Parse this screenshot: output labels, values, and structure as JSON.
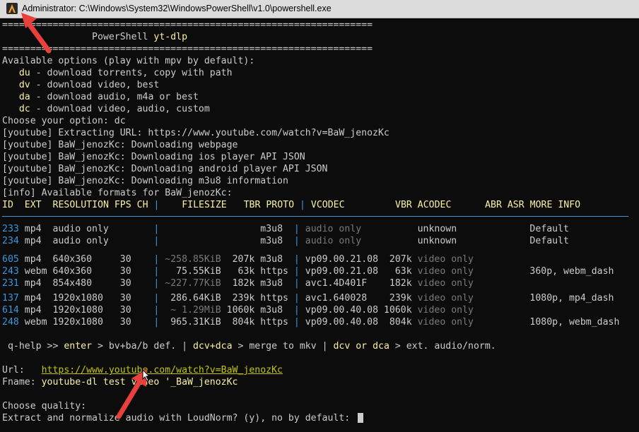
{
  "window": {
    "title": "Administrator: C:\\Windows\\System32\\WindowsPowerShell\\v1.0\\powershell.exe",
    "icon": "powershell-icon"
  },
  "banner": {
    "rule": "==================================================================",
    "title_plain": "PowerShell ",
    "title_accent": "yt-dlp"
  },
  "menu": {
    "header": "Available options (play with mpv by default):",
    "options": [
      {
        "key": "du",
        "desc": " - download torrents, copy with path"
      },
      {
        "key": "dv",
        "desc": " - download video, best"
      },
      {
        "key": "da",
        "desc": " - download audio, m4a or best"
      },
      {
        "key": "dc",
        "desc": " - download video, audio, custom"
      }
    ],
    "prompt": "Choose your option: dc"
  },
  "log": [
    "[youtube] Extracting URL: https://www.youtube.com/watch?v=BaW_jenozKc",
    "[youtube] BaW_jenozKc: Downloading webpage",
    "[youtube] BaW_jenozKc: Downloading ios player API JSON",
    "[youtube] BaW_jenozKc: Downloading android player API JSON",
    "[youtube] BaW_jenozKc: Downloading m3u8 information",
    "[info] Available formats for BaW_jenozKc:"
  ],
  "table": {
    "headers": [
      "ID",
      "EXT",
      "RESOLUTION",
      "FPS",
      "CH",
      "FILESIZE",
      "TBR",
      "PROTO",
      "VCODEC",
      "VBR",
      "ACODEC",
      "ABR",
      "ASR",
      "MORE INFO"
    ],
    "rows": [
      {
        "id": "233",
        "ext": "mp4",
        "res": "audio only",
        "fps": "",
        "filesize": "",
        "tbr": "",
        "proto": "m3u8",
        "vcodec": "audio only",
        "vbr": "",
        "acodec": "unknown",
        "more": "Default"
      },
      {
        "id": "234",
        "ext": "mp4",
        "res": "audio only",
        "fps": "",
        "filesize": "",
        "tbr": "",
        "proto": "m3u8",
        "vcodec": "audio only",
        "vbr": "",
        "acodec": "unknown",
        "more": "Default"
      },
      {
        "id": "605",
        "ext": "mp4",
        "res": "640x360",
        "fps": "30",
        "filesize": "~258.85KiB",
        "tbr": "207k",
        "proto": "m3u8",
        "vcodec": "vp09.00.21.08",
        "vbr": "207k",
        "acodec": "video only",
        "more": ""
      },
      {
        "id": "243",
        "ext": "webm",
        "res": "640x360",
        "fps": "30",
        "filesize": "75.55KiB",
        "tbr": "63k",
        "proto": "https",
        "vcodec": "vp09.00.21.08",
        "vbr": "63k",
        "acodec": "video only",
        "more": "360p, webm_dash"
      },
      {
        "id": "231",
        "ext": "mp4",
        "res": "854x480",
        "fps": "30",
        "filesize": "~227.77KiB",
        "tbr": "182k",
        "proto": "m3u8",
        "vcodec": "avc1.4D401F",
        "vbr": "182k",
        "acodec": "video only",
        "more": ""
      },
      {
        "id": "137",
        "ext": "mp4",
        "res": "1920x1080",
        "fps": "30",
        "filesize": "286.64KiB",
        "tbr": "239k",
        "proto": "https",
        "vcodec": "avc1.640028",
        "vbr": "239k",
        "acodec": "video only",
        "more": "1080p, mp4_dash"
      },
      {
        "id": "614",
        "ext": "mp4",
        "res": "1920x1080",
        "fps": "30",
        "filesize": "~ 1.29MiB",
        "tbr": "1060k",
        "proto": "m3u8",
        "vcodec": "vp09.00.40.08",
        "vbr": "1060k",
        "acodec": "video only",
        "more": ""
      },
      {
        "id": "248",
        "ext": "webm",
        "res": "1920x1080",
        "fps": "30",
        "filesize": "965.31KiB",
        "tbr": "804k",
        "proto": "https",
        "vcodec": "vp09.00.40.08",
        "vbr": "804k",
        "acodec": "video only",
        "more": "1080p, webm_dash"
      }
    ]
  },
  "help": {
    "p1": " q-help >> ",
    "p2": "enter",
    "p3": " > bv+ba/b def. | ",
    "p4": "dcv+dca",
    "p5": " > merge to mkv | ",
    "p6": "dcv",
    "p7": " or ",
    "p8": "dca",
    "p9": " > ext. audio/norm."
  },
  "fields": {
    "url_label": "Url:   ",
    "url_value": "https://www.youtube.com/watch?v=BaW_jenozKc",
    "fname_label": "Fname: ",
    "fname_value": "youtube-dl test video '_BaW_jenozKc"
  },
  "prompts": {
    "quality": "Choose quality:",
    "loudnorm": "Extract and normalize audio with LoudNorm? (y), no by default: "
  },
  "annotation_color": "#e8403a"
}
